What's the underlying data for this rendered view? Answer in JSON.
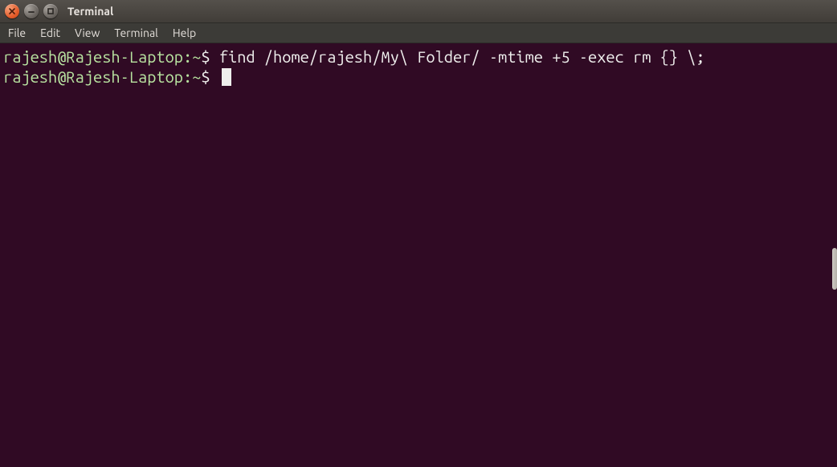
{
  "window": {
    "title": "Terminal"
  },
  "menu": {
    "file": "File",
    "edit": "Edit",
    "view": "View",
    "terminal": "Terminal",
    "help": "Help"
  },
  "lines": {
    "l0": {
      "prompt": "rajesh@Rajesh-Laptop:~",
      "dollar": "$ ",
      "cmd": "find /home/rajesh/My\\ Folder/ -mtime +5 -exec rm {} \\;"
    },
    "l1": {
      "prompt": "rajesh@Rajesh-Laptop:~",
      "dollar": "$ "
    }
  },
  "icons": {
    "close": "close-icon",
    "min": "minimize-icon",
    "max": "maximize-icon"
  }
}
